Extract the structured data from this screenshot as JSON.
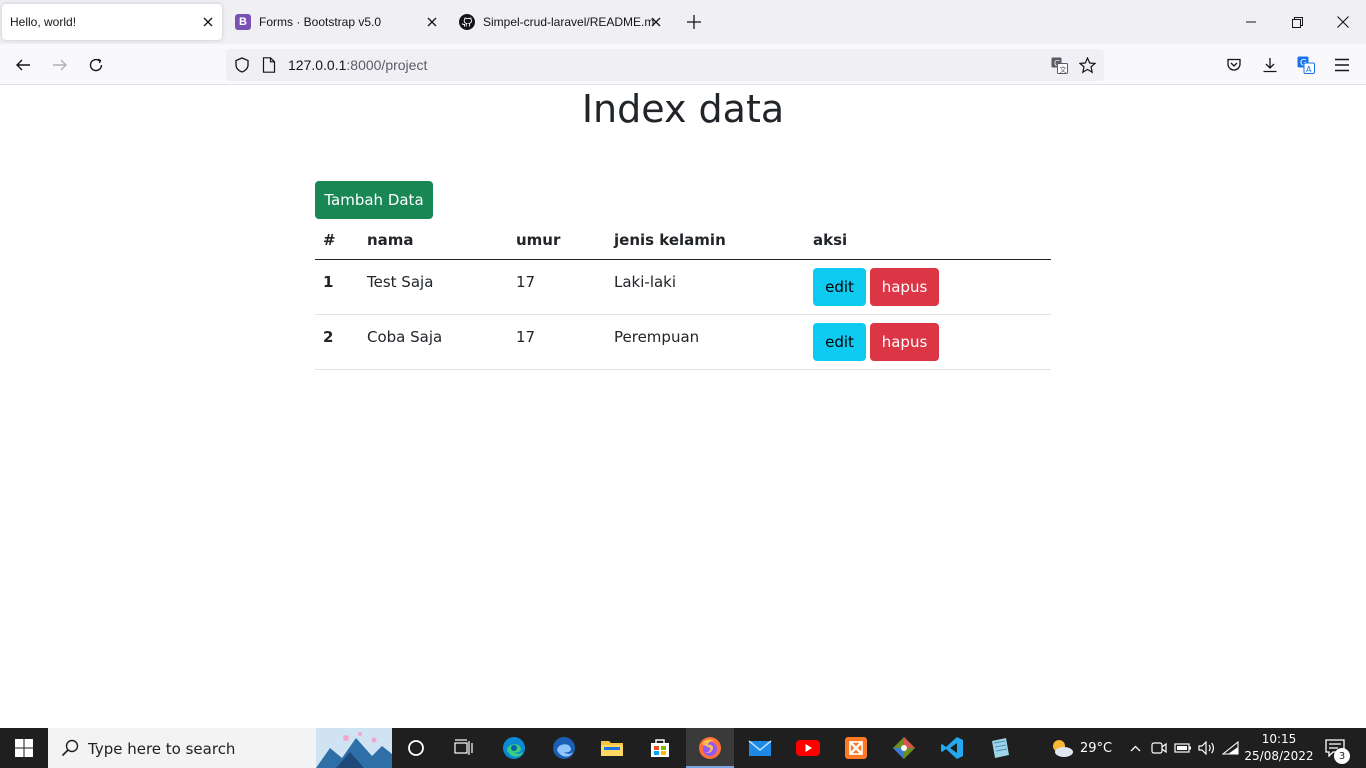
{
  "browser": {
    "tabs": [
      {
        "title": "Hello, world!",
        "active": true
      },
      {
        "title": "Forms · Bootstrap v5.0",
        "active": false
      },
      {
        "title": "Simpel-crud-laravel/README.m",
        "active": false
      }
    ],
    "url_host": "127.0.0.1",
    "url_rest": ":8000/project",
    "icons": [
      "back-arrow",
      "forward-arrow",
      "reload",
      "shield",
      "page",
      "translate",
      "star",
      "pocket",
      "download",
      "extension",
      "hamburger-menu"
    ]
  },
  "page": {
    "title": "Index data",
    "add_button": "Tambah Data",
    "table": {
      "headers": [
        "#",
        "nama",
        "umur",
        "jenis kelamin",
        "aksi"
      ],
      "rows": [
        {
          "no": "1",
          "nama": "Test Saja",
          "umur": "17",
          "jk": "Laki-laki",
          "edit": "edit",
          "hapus": "hapus"
        },
        {
          "no": "2",
          "nama": "Coba Saja",
          "umur": "17",
          "jk": "Perempuan",
          "edit": "edit",
          "hapus": "hapus"
        }
      ]
    },
    "colors": {
      "success": "#198754",
      "info": "#0dcaf0",
      "danger": "#dc3545"
    }
  },
  "taskbar": {
    "search_placeholder": "Type here to search",
    "temperature": "29°C",
    "time": "10:15",
    "date": "25/08/2022",
    "notification_count": "3"
  }
}
